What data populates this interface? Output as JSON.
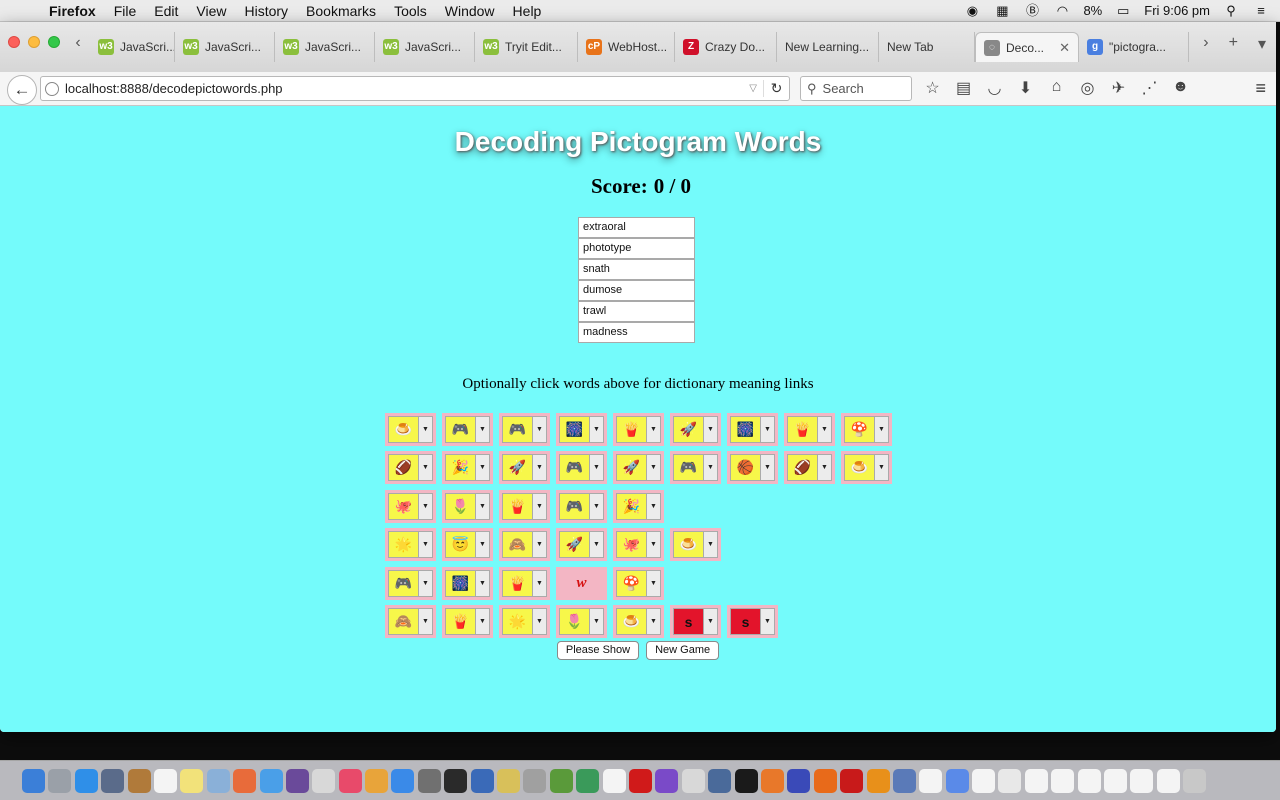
{
  "menubar": {
    "app": "Firefox",
    "items": [
      "File",
      "Edit",
      "View",
      "History",
      "Bookmarks",
      "Tools",
      "Window",
      "Help"
    ],
    "battery": "8%",
    "clock": "Fri 9:06 pm"
  },
  "tabs": [
    {
      "label": "JavaScri...",
      "icon_color": "#8bbf3c",
      "icon_text": "w3"
    },
    {
      "label": "JavaScri...",
      "icon_color": "#8bbf3c",
      "icon_text": "w3"
    },
    {
      "label": "JavaScri...",
      "icon_color": "#8bbf3c",
      "icon_text": "w3"
    },
    {
      "label": "JavaScri...",
      "icon_color": "#8bbf3c",
      "icon_text": "w3"
    },
    {
      "label": "Tryit Edit...",
      "icon_color": "#8bbf3c",
      "icon_text": "w3"
    },
    {
      "label": "WebHost...",
      "icon_color": "#e8731a",
      "icon_text": "cP"
    },
    {
      "label": "Crazy Do...",
      "icon_color": "#d0102a",
      "icon_text": "Z"
    },
    {
      "label": "New Learning...",
      "icon_color": "",
      "icon_text": ""
    },
    {
      "label": "New Tab",
      "icon_color": "",
      "icon_text": ""
    },
    {
      "label": "Deco...",
      "icon_color": "#888888",
      "icon_text": "◌",
      "active": true
    },
    {
      "label": "\"pictogra...",
      "icon_color": "#4a7fe0",
      "icon_text": "g"
    }
  ],
  "navbar": {
    "url": "localhost:8888/decodepictowords.php",
    "search_placeholder": "Search"
  },
  "page": {
    "title": "Decoding Pictogram Words",
    "score_label": "Score:",
    "score_value": "0 / 0",
    "words": [
      "extraoral",
      "phototype",
      "snath",
      "dumose",
      "trawl",
      "madness"
    ],
    "hint": "Optionally click words above for dictionary meaning links",
    "show_button": "Please Show",
    "new_game_button": "New Game"
  },
  "grid": [
    [
      {
        "e": "🍮"
      },
      {
        "e": "🎮"
      },
      {
        "e": "🎮"
      },
      {
        "e": "🎆"
      },
      {
        "e": "🍟"
      },
      {
        "e": "🚀"
      },
      {
        "e": "🎆"
      },
      {
        "e": "🍟"
      },
      {
        "e": "🍄"
      }
    ],
    [
      {
        "e": "🏈"
      },
      {
        "e": "🎉"
      },
      {
        "e": "🚀"
      },
      {
        "e": "🎮"
      },
      {
        "e": "🚀"
      },
      {
        "e": "🎮"
      },
      {
        "e": "🏀"
      },
      {
        "e": "🏈"
      },
      {
        "e": "🍮"
      }
    ],
    [
      {
        "e": "🐙"
      },
      {
        "e": "🌷"
      },
      {
        "e": "🍟"
      },
      {
        "e": "🎮"
      },
      {
        "e": "🎉"
      }
    ],
    [
      {
        "e": "🌟"
      },
      {
        "e": "😇"
      },
      {
        "e": "🙈"
      },
      {
        "e": "🚀"
      },
      {
        "e": "🐙"
      },
      {
        "e": "🍮"
      }
    ],
    [
      {
        "e": "🎮"
      },
      {
        "e": "🎆"
      },
      {
        "e": "🍟"
      },
      {
        "letter": "w"
      },
      {
        "e": "🍄"
      }
    ],
    [
      {
        "e": "🙈"
      },
      {
        "e": "🍟"
      },
      {
        "e": "🌟"
      },
      {
        "e": "🌷"
      },
      {
        "e": "🍮"
      },
      {
        "e": "s",
        "red": true
      },
      {
        "e": "s",
        "red": true
      }
    ]
  ]
}
